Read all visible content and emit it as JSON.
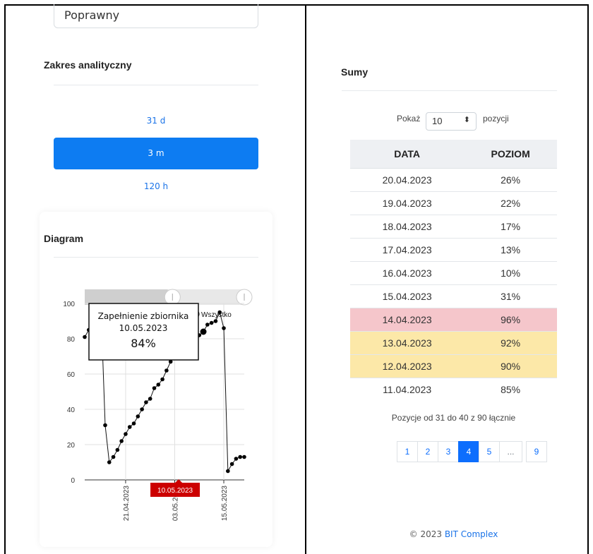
{
  "left": {
    "status_value": "Poprawny",
    "analytic_range": {
      "title": "Zakres analityczny",
      "options": [
        "31 d",
        "3 m",
        "120 h"
      ],
      "selected": "3 m"
    },
    "diagram": {
      "title": "Diagram",
      "reset_label": "Wszystko",
      "tooltip": {
        "series": "Zapełnienie zbiornika",
        "date": "10.05.2023",
        "value": "84%"
      },
      "crosshair_label": "10.05.2023"
    }
  },
  "right": {
    "title": "Sumy",
    "show_prefix": "Pokaż",
    "show_value": "10",
    "show_suffix": "pozycji",
    "columns": [
      "DATA",
      "POZIOM"
    ],
    "rows": [
      {
        "date": "20.04.2023",
        "level": "26%",
        "highlight": ""
      },
      {
        "date": "19.04.2023",
        "level": "22%",
        "highlight": ""
      },
      {
        "date": "18.04.2023",
        "level": "17%",
        "highlight": ""
      },
      {
        "date": "17.04.2023",
        "level": "13%",
        "highlight": ""
      },
      {
        "date": "16.04.2023",
        "level": "10%",
        "highlight": ""
      },
      {
        "date": "15.04.2023",
        "level": "31%",
        "highlight": ""
      },
      {
        "date": "14.04.2023",
        "level": "96%",
        "highlight": "red"
      },
      {
        "date": "13.04.2023",
        "level": "92%",
        "highlight": "yellow"
      },
      {
        "date": "12.04.2023",
        "level": "90%",
        "highlight": "yellow"
      },
      {
        "date": "11.04.2023",
        "level": "85%",
        "highlight": ""
      }
    ],
    "info": "Pozycje od 31 do 40 z 90 łącznie",
    "pagination": [
      "1",
      "2",
      "3",
      "4",
      "5",
      "...",
      "9"
    ],
    "active_page": "4"
  },
  "footer": {
    "copyright": "© 2023",
    "brand": "BIT Complex"
  },
  "colors": {
    "accent": "#0d7cf2",
    "danger_row": "#f5c6cb",
    "warning_row": "#fce8a8",
    "crosshair_label": "#cc0000"
  },
  "chart_data": {
    "type": "scatter",
    "title": "",
    "xlabel": "",
    "ylabel": "",
    "ylim": [
      0,
      100
    ],
    "y_ticks": [
      0,
      20,
      40,
      60,
      80,
      100
    ],
    "x_tick_labels": [
      "21.04.2023",
      "03.05.2023",
      "15.05.2023"
    ],
    "series": [
      {
        "name": "Zapełnienie zbiornika",
        "x": [
          "11.04",
          "12.04",
          "13.04",
          "14.04",
          "15.04",
          "16.04",
          "17.04",
          "18.04",
          "19.04",
          "20.04",
          "21.04",
          "22.04",
          "23.04",
          "24.04",
          "25.04",
          "26.04",
          "27.04",
          "28.04",
          "29.04",
          "30.04",
          "01.05",
          "02.05",
          "03.05",
          "04.05",
          "05.05",
          "06.05",
          "07.05",
          "08.05",
          "09.05",
          "10.05",
          "11.05",
          "12.05",
          "13.05",
          "14.05",
          "15.05",
          "16.05",
          "17.05",
          "18.05",
          "19.05",
          "20.05"
        ],
        "y": [
          81,
          85,
          90,
          92,
          96,
          31,
          10,
          13,
          17,
          22,
          26,
          30,
          32,
          36,
          40,
          44,
          46,
          52,
          54,
          57,
          62,
          67,
          70,
          73,
          74,
          74,
          74,
          75,
          82,
          84,
          88,
          89,
          90,
          95,
          86,
          5,
          9,
          12,
          13,
          13
        ]
      }
    ]
  }
}
